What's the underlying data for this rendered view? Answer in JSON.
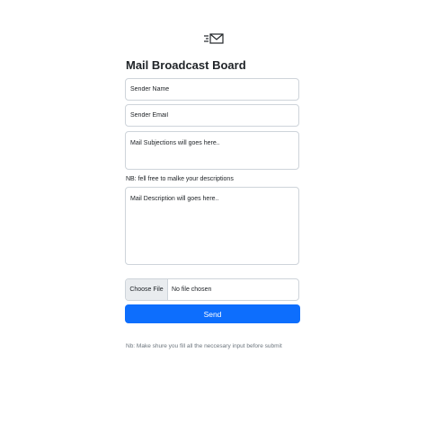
{
  "header": {
    "logo_icon": "mail-send-icon",
    "title": "Mail Broadcast Board"
  },
  "form": {
    "sender_name": {
      "placeholder": "Sender Name",
      "value": ""
    },
    "sender_email": {
      "placeholder": "Sender Email",
      "value": ""
    },
    "subject": {
      "placeholder": "Mail Subjections will goes here..",
      "value": ""
    },
    "description_note": "NB: fell free to malke your descriptions",
    "description": {
      "placeholder": "Mail Description will goes here..",
      "value": ""
    },
    "file": {
      "button_label": "Choose File",
      "status": "No file chosen"
    },
    "send_label": "Send"
  },
  "footer": {
    "note": "Nb: Make shure you fill all the neccesary input before submit"
  },
  "colors": {
    "primary": "#0d6efd",
    "border": "#ced4da",
    "muted_text": "#6c757d",
    "file_button_bg": "#e9ecef"
  }
}
